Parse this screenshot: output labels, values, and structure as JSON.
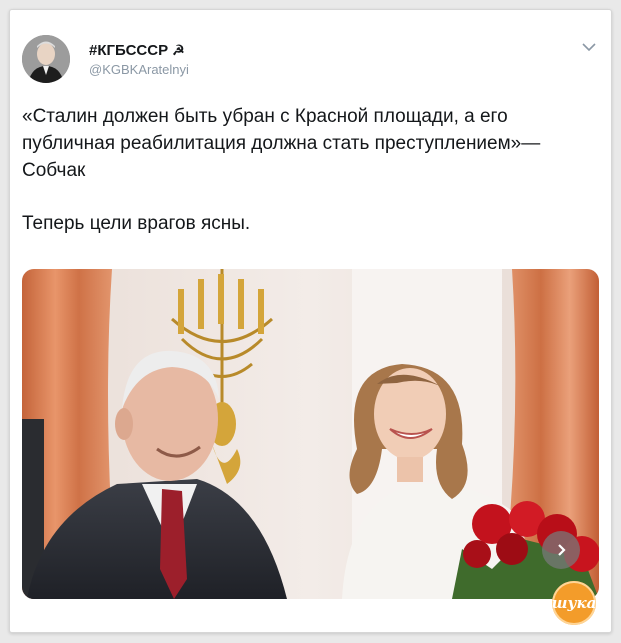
{
  "tweet": {
    "author": {
      "name": "#КГБСССР",
      "name_symbol": "☭",
      "handle": "@KGBKAratelnyi",
      "avatar_icon": "avatar-portrait-icon"
    },
    "menu_icon": "chevron-down-icon",
    "text": {
      "line1": "«Сталин должен быть убран с Красной площади, а его публичная реабилитация должна стать преступлением»—Собчак",
      "line2": "Теперь цели врагов ясны."
    },
    "media": {
      "next_icon": "chevron-right-icon"
    }
  },
  "watermark": {
    "text": "шука"
  },
  "colors": {
    "text": "#14171a",
    "handle": "#8b98a5",
    "card_bg": "#ffffff",
    "page_bg": "#e9e9e9",
    "watermark": "#f39c2a"
  }
}
